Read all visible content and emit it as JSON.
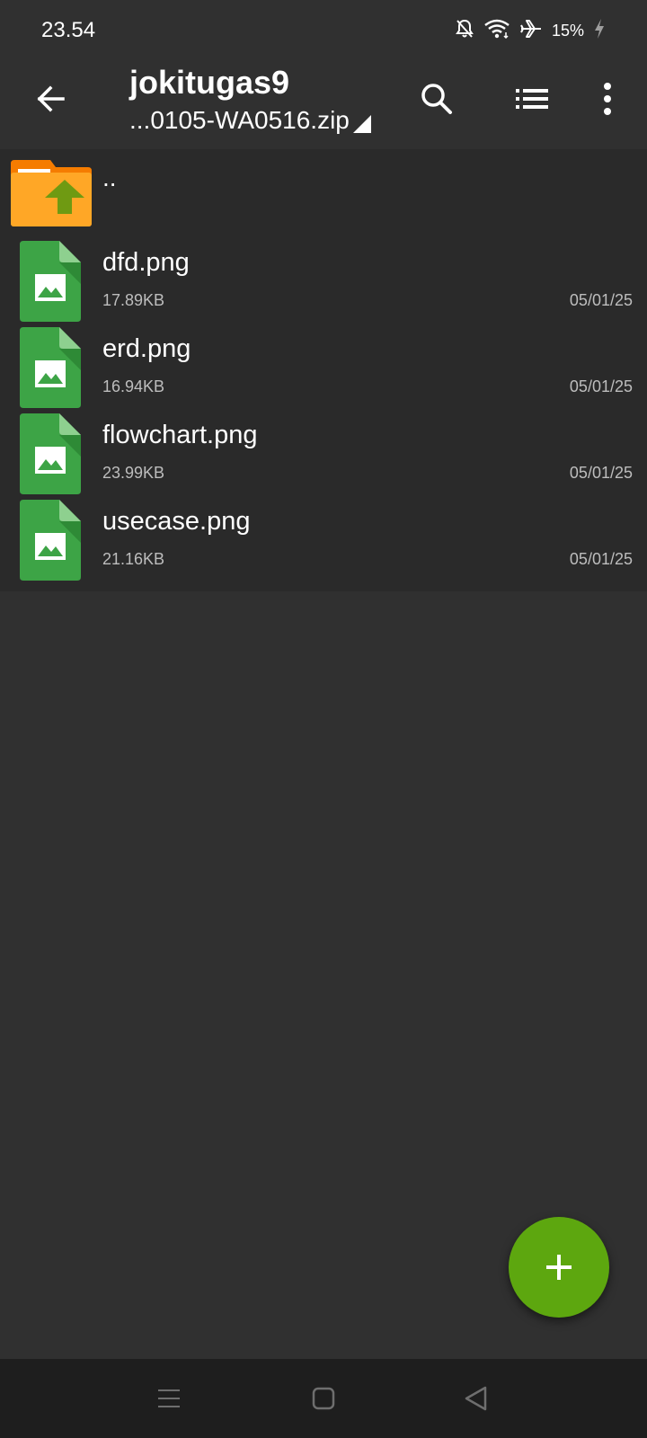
{
  "status_bar": {
    "time": "23.54",
    "battery_percent": "15%",
    "icons": [
      "bell-off-icon",
      "wifi-icon",
      "airplane-icon",
      "charging-icon"
    ]
  },
  "app_bar": {
    "title": "jokitugas9",
    "subtitle": "...0105-WA0516.zip",
    "actions": [
      "search-icon",
      "list-view-icon",
      "more-options-icon"
    ]
  },
  "file_list": {
    "parent_label": "..",
    "files": [
      {
        "name": "dfd.png",
        "size": "17.89KB",
        "date": "05/01/25"
      },
      {
        "name": "erd.png",
        "size": "16.94KB",
        "date": "05/01/25"
      },
      {
        "name": "flowchart.png",
        "size": "23.99KB",
        "date": "05/01/25"
      },
      {
        "name": "usecase.png",
        "size": "21.16KB",
        "date": "05/01/25"
      }
    ]
  },
  "fab": {
    "icon": "plus-icon"
  },
  "nav_bar": {
    "buttons": [
      "menu-nav-icon",
      "home-nav-icon",
      "back-nav-icon"
    ]
  },
  "colors": {
    "background": "#303030",
    "list_background": "#2a2a2a",
    "fab": "#5da70f",
    "file_icon": "#3da446",
    "folder_icon": "#f7a228",
    "up_arrow": "#6f9a12"
  }
}
